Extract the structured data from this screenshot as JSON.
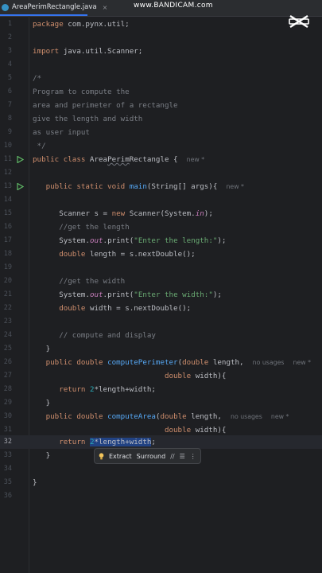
{
  "tab": {
    "filename": "AreaPerimRectangle.java",
    "close": "×"
  },
  "watermark": "www.BANDICAM.com",
  "colors": {
    "background": "#1e1f22",
    "keyword": "#cf8e6d",
    "comment": "#7a7e85",
    "string": "#6aab73",
    "number": "#2aacb8",
    "function": "#56a8f5",
    "selection": "#214283"
  },
  "hints": {
    "new": "new *",
    "no_usages": "no usages"
  },
  "code": {
    "l1_kw": "package",
    "l1_rest": " com.pynx.util;",
    "l3_kw": "import",
    "l3_rest": " java.util.Scanner;",
    "l5": "/*",
    "l6": "*",
    "l7": "Program to compute the",
    "l8": "area and perimeter of a rectangle",
    "l9": "give the length and width",
    "l10": "as user input",
    "l11": " */",
    "l12_kw": "public class ",
    "l12_cls_a": "Area",
    "l12_cls_b": "Perim",
    "l12_cls_c": "Rectangle {",
    "l14_kw": "public static void ",
    "l14_fn": "main",
    "l14_rest": "(String[] args){",
    "l16_a": "Scanner s = ",
    "l16_kw": "new",
    "l16_b": " Scanner(System.",
    "l16_st": "in",
    "l16_c": ");",
    "l17": "//get the length",
    "l18_a": "System.",
    "l18_st": "out",
    "l18_b": ".print(",
    "l18_str": "\"Enter the length:\"",
    "l18_c": ");",
    "l19_kw": "double",
    "l19_rest": " length = s.nextDouble();",
    "l21": "//get the width",
    "l22_a": "System.",
    "l22_st": "out",
    "l22_b": ".print(",
    "l22_str": "\"Enter the width:\"",
    "l22_c": ");",
    "l23_kw": "double",
    "l23_rest": " width = s.nextDouble();",
    "l25": "// compute and display",
    "l26": "}",
    "l27_kw": "public double ",
    "l27_fn": "computePerimeter",
    "l27_a": "(",
    "l27_kw2": "double",
    "l27_b": " length,",
    "l28_kw": "double",
    "l28_b": " width){",
    "l29_kw": "return ",
    "l29_num": "2",
    "l29_rest": "*length+width;",
    "l30": "}",
    "l31_kw": "public double ",
    "l31_fn": "computeArea",
    "l31_a": "(",
    "l31_kw2": "double",
    "l31_b": " length,",
    "l32_kw": "double",
    "l32_b": " width){",
    "l33_kw": "return ",
    "l33_num": "2",
    "l33_rest": "*length+width",
    "l33_end": ";",
    "l34": "}",
    "l36": "}"
  },
  "popup": {
    "extract": "Extract",
    "surround": "Surround",
    "comment_sym": "//",
    "list_sym": "☰",
    "more_sym": "⋮"
  }
}
